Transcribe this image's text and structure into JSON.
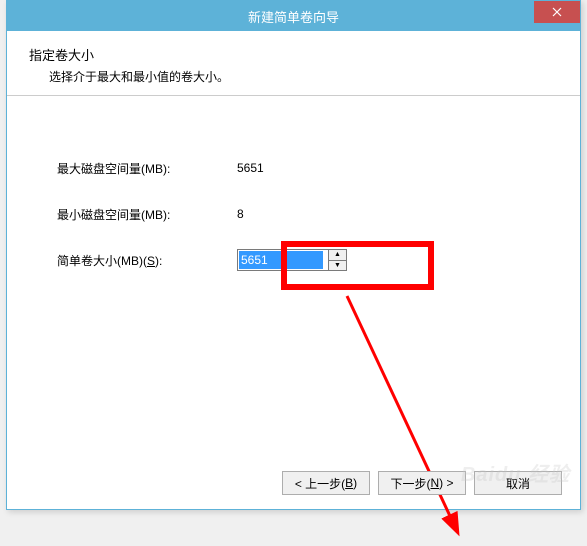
{
  "titlebar": {
    "title": "新建简单卷向导"
  },
  "header": {
    "title": "指定卷大小",
    "subtitle": "选择介于最大和最小值的卷大小。"
  },
  "fields": {
    "max_space": {
      "label": "最大磁盘空间量(MB):",
      "value": "5651"
    },
    "min_space": {
      "label": "最小磁盘空间量(MB):",
      "value": "8"
    },
    "volume_size": {
      "label_pre": "简单卷大小(MB)(",
      "label_key": "S",
      "label_post": "):",
      "value": "5651"
    }
  },
  "buttons": {
    "back_pre": "< 上一步(",
    "back_key": "B",
    "back_post": ")",
    "next_pre": "下一步(",
    "next_key": "N",
    "next_post": ") >",
    "cancel": "取消"
  },
  "watermark": "Baidu 经验"
}
